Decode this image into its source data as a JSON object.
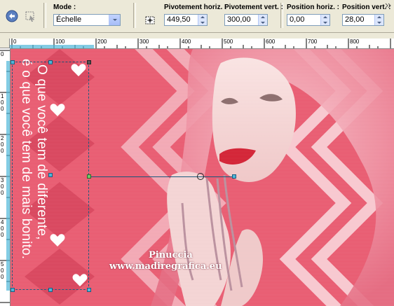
{
  "toolbar": {
    "mode_label": "Mode :",
    "mode_value": "Échelle",
    "pivot_h_label": "Pivotement horiz. :",
    "pivot_h_value": "449,50",
    "pivot_v_label": "Pivotement vert. :",
    "pivot_v_value": "300,00",
    "pos_h_label": "Position horiz. :",
    "pos_h_value": "0,00",
    "pos_v_label": "Position vert. :",
    "pos_v_value": "28,00"
  },
  "ruler": {
    "h_ticks": [
      "0",
      "100",
      "200",
      "300",
      "400",
      "500",
      "600",
      "700",
      "800"
    ],
    "v_ticks": [
      "0",
      "100",
      "200",
      "300",
      "400",
      "500"
    ]
  },
  "canvas": {
    "vertical_text_line1": "O que você tem de diferente,",
    "vertical_text_line2": "é o que você tem de mais bonito.",
    "watermark_line1": "Pinuccia",
    "watermark_line2": "www.madiregrafica.eu"
  },
  "colors": {
    "pink_bg": "#e8596f",
    "toolbar_bg": "#ece9d8",
    "handle": "#4fb6d8"
  }
}
